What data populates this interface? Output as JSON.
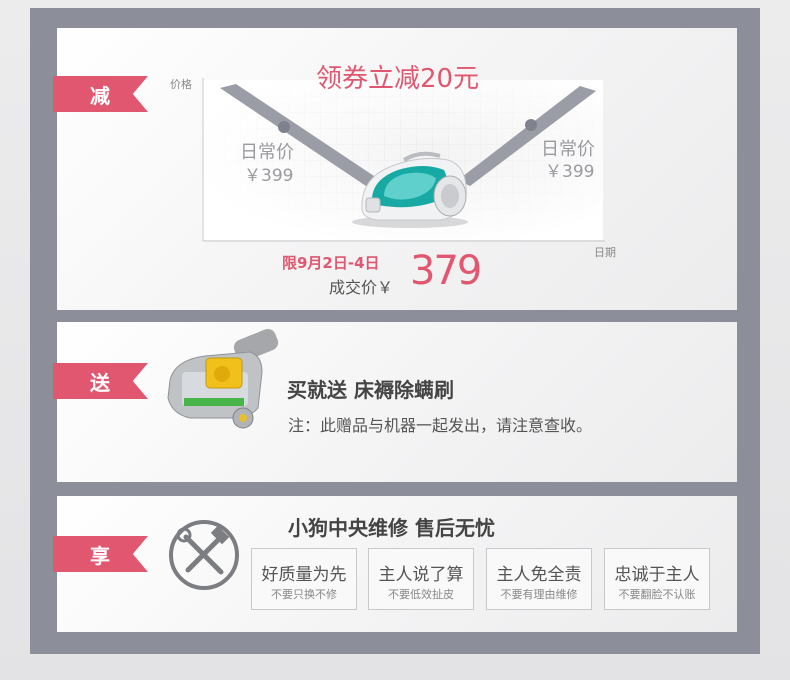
{
  "colors": {
    "accent": "#e0576f",
    "frame": "#8c8f99",
    "teal": "#1aa7a3"
  },
  "ribbons": {
    "reduce": "减",
    "gift": "送",
    "enjoy": "享"
  },
  "chart_data": {
    "type": "line",
    "title": "领券立减20元",
    "ylabel": "价格",
    "xlabel": "日期",
    "points": [
      {
        "label": "日常价",
        "price": "￥399"
      },
      {
        "label": "日常价",
        "price": "￥399"
      }
    ],
    "promo": {
      "date_range": "限9月2日-4日",
      "price_label": "成交价￥",
      "price": "379"
    }
  },
  "gift": {
    "title": "买就送 床褥除螨刷",
    "note": "注：此赠品与机器一起发出，请注意查收。"
  },
  "service": {
    "title": "小狗中央维修 售后无忧",
    "icon": "tools-icon",
    "cards": [
      {
        "title": "好质量为先",
        "sub": "不要只换不修"
      },
      {
        "title": "主人说了算",
        "sub": "不要低效扯皮"
      },
      {
        "title": "主人免全责",
        "sub": "不要有理由维修"
      },
      {
        "title": "忠诚于主人",
        "sub": "不要翻脸不认账"
      }
    ]
  }
}
